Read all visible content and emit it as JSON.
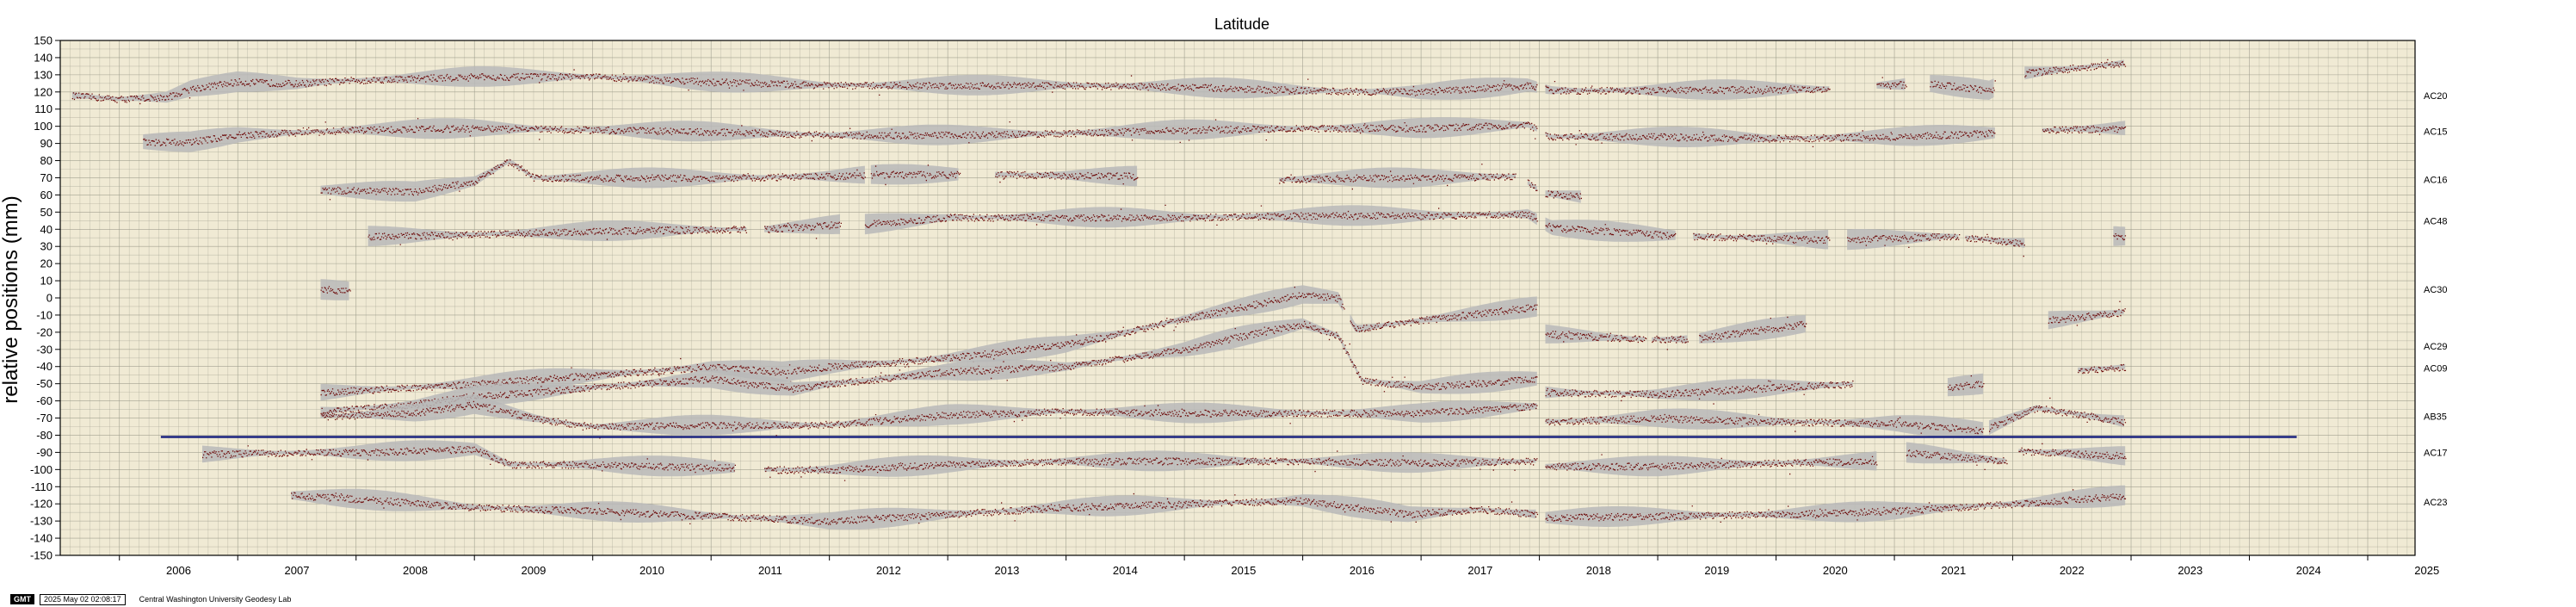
{
  "chart_data": {
    "type": "scatter",
    "title": "Latitude",
    "ylabel": "relative positions (mm)",
    "xlabel": "",
    "xlim": [
      2005.5,
      2025.4
    ],
    "ylim": [
      -150,
      150
    ],
    "y_ticks": [
      150,
      140,
      130,
      120,
      110,
      100,
      90,
      80,
      70,
      60,
      50,
      40,
      30,
      20,
      10,
      0,
      -10,
      -20,
      -30,
      -40,
      -50,
      -60,
      -70,
      -80,
      -90,
      -100,
      -110,
      -120,
      -130,
      -140,
      -150
    ],
    "x_ticks": [
      2006,
      2007,
      2008,
      2009,
      2010,
      2011,
      2012,
      2013,
      2014,
      2015,
      2016,
      2017,
      2018,
      2019,
      2020,
      2021,
      2022,
      2023,
      2024,
      2025
    ],
    "x_tick_labels": [
      "2006",
      "2007",
      "2008",
      "2009",
      "2010",
      "2011",
      "2012",
      "2013",
      "2014",
      "2015",
      "2016",
      "2017",
      "2018",
      "2019",
      "2020",
      "2021",
      "2022",
      "2023",
      "2024",
      "2025"
    ],
    "grid": true,
    "background_color": "#f0ead4",
    "point_color": "#6e0d0d",
    "error_band_color": "#b8b8b8",
    "reference_line": {
      "y": -81,
      "x_start": 2006.35,
      "x_end": 2024.4,
      "color": "#1a237e"
    },
    "series": [
      {
        "name": "AC20",
        "offset": 118,
        "segments": [
          [
            2005.6,
            2017.98
          ],
          [
            2018.05,
            2020.45
          ],
          [
            2020.85,
            2021.1
          ],
          [
            2021.3,
            2021.85
          ],
          [
            2022.1,
            2022.95
          ]
        ],
        "anchors": [
          [
            2005.6,
            118
          ],
          [
            2006.0,
            116
          ],
          [
            2006.4,
            117
          ],
          [
            2006.6,
            122
          ],
          [
            2007.0,
            126
          ],
          [
            2007.5,
            125
          ],
          [
            2008.0,
            127
          ],
          [
            2009.0,
            129
          ],
          [
            2010.0,
            129
          ],
          [
            2011.0,
            126
          ],
          [
            2012.0,
            124
          ],
          [
            2013.0,
            124
          ],
          [
            2014.0,
            124
          ],
          [
            2015.0,
            123
          ],
          [
            2016.0,
            121
          ],
          [
            2017.0,
            120
          ],
          [
            2017.9,
            124
          ],
          [
            2018.1,
            121
          ],
          [
            2019.0,
            121
          ],
          [
            2020.4,
            122
          ],
          [
            2020.9,
            124
          ],
          [
            2021.3,
            125
          ],
          [
            2021.8,
            121
          ],
          [
            2022.1,
            131
          ],
          [
            2022.95,
            137
          ]
        ]
      },
      {
        "name": "AC15",
        "offset": 97,
        "segments": [
          [
            2006.2,
            2017.98
          ],
          [
            2018.05,
            2021.85
          ],
          [
            2022.25,
            2022.95
          ]
        ],
        "anchors": [
          [
            2006.2,
            91
          ],
          [
            2006.6,
            91
          ],
          [
            2007.0,
            95
          ],
          [
            2008.0,
            98
          ],
          [
            2009.0,
            99
          ],
          [
            2010.0,
            98
          ],
          [
            2011.0,
            97
          ],
          [
            2012.0,
            95
          ],
          [
            2013.0,
            95
          ],
          [
            2014.0,
            96
          ],
          [
            2015.0,
            98
          ],
          [
            2016.0,
            99
          ],
          [
            2017.0,
            99
          ],
          [
            2017.9,
            101
          ],
          [
            2018.1,
            94
          ],
          [
            2019.0,
            94
          ],
          [
            2020.0,
            93
          ],
          [
            2021.0,
            94
          ],
          [
            2021.8,
            96
          ],
          [
            2022.3,
            98
          ],
          [
            2022.95,
            99
          ]
        ]
      },
      {
        "name": "AC16",
        "offset": 69,
        "segments": [
          [
            2007.7,
            2012.3
          ],
          [
            2012.35,
            2013.1
          ],
          [
            2013.4,
            2014.6
          ],
          [
            2015.8,
            2017.8
          ],
          [
            2017.9,
            2017.98
          ],
          [
            2018.05,
            2018.35
          ]
        ],
        "anchors": [
          [
            2007.7,
            63
          ],
          [
            2008.5,
            62
          ],
          [
            2009.0,
            68
          ],
          [
            2009.3,
            80
          ],
          [
            2009.5,
            70
          ],
          [
            2010.0,
            70
          ],
          [
            2011.0,
            70
          ],
          [
            2012.0,
            71
          ],
          [
            2012.4,
            72
          ],
          [
            2013.0,
            72
          ],
          [
            2013.4,
            72
          ],
          [
            2014.6,
            71
          ],
          [
            2015.8,
            69
          ],
          [
            2016.5,
            70
          ],
          [
            2017.0,
            70
          ],
          [
            2017.8,
            71
          ],
          [
            2018.05,
            61
          ],
          [
            2018.35,
            59
          ]
        ]
      },
      {
        "name": "AC48",
        "offset": 45,
        "segments": [
          [
            2008.1,
            2011.3
          ],
          [
            2011.45,
            2012.1
          ],
          [
            2012.3,
            2017.98
          ],
          [
            2018.05,
            2019.15
          ],
          [
            2019.3,
            2020.45
          ],
          [
            2020.6,
            2021.55
          ],
          [
            2021.6,
            2022.1
          ],
          [
            2022.85,
            2022.95
          ]
        ],
        "anchors": [
          [
            2008.1,
            36
          ],
          [
            2009.0,
            37
          ],
          [
            2010.0,
            39
          ],
          [
            2011.0,
            40
          ],
          [
            2011.45,
            40
          ],
          [
            2012.1,
            43
          ],
          [
            2012.3,
            43
          ],
          [
            2013.0,
            47
          ],
          [
            2014.0,
            47
          ],
          [
            2015.0,
            47
          ],
          [
            2016.0,
            48
          ],
          [
            2017.0,
            48
          ],
          [
            2017.9,
            49
          ],
          [
            2018.1,
            41
          ],
          [
            2019.0,
            37
          ],
          [
            2019.3,
            36
          ],
          [
            2020.4,
            34
          ],
          [
            2020.6,
            34
          ],
          [
            2021.5,
            36
          ],
          [
            2022.1,
            32
          ],
          [
            2022.85,
            36
          ],
          [
            2022.95,
            36
          ]
        ]
      },
      {
        "name": "AC30",
        "offset": 5,
        "segments": [
          [
            2007.7,
            2007.95
          ]
        ],
        "anchors": [
          [
            2007.7,
            5
          ],
          [
            2007.95,
            4
          ]
        ]
      },
      {
        "name": "AC29",
        "offset": -28,
        "segments": [
          [
            2007.7,
            2016.35
          ],
          [
            2016.4,
            2017.98
          ],
          [
            2018.05,
            2018.9
          ],
          [
            2018.95,
            2019.25
          ],
          [
            2019.35,
            2020.25
          ],
          [
            2022.3,
            2022.95
          ]
        ],
        "anchors": [
          [
            2007.7,
            -55
          ],
          [
            2008.5,
            -52
          ],
          [
            2009.0,
            -50
          ],
          [
            2010.0,
            -45
          ],
          [
            2011.0,
            -40
          ],
          [
            2011.6,
            -43
          ],
          [
            2012.0,
            -40
          ],
          [
            2013.0,
            -35
          ],
          [
            2014.0,
            -27
          ],
          [
            2014.5,
            -20
          ],
          [
            2015.0,
            -12
          ],
          [
            2015.5,
            -5
          ],
          [
            2016.0,
            2
          ],
          [
            2016.3,
            0
          ],
          [
            2016.45,
            -18
          ],
          [
            2017.0,
            -13
          ],
          [
            2017.98,
            -5
          ],
          [
            2018.05,
            -21
          ],
          [
            2018.9,
            -24
          ],
          [
            2019.3,
            -24
          ],
          [
            2020.25,
            -15
          ],
          [
            2022.3,
            -13
          ],
          [
            2022.95,
            -8
          ]
        ]
      },
      {
        "name": "AC09",
        "offset": -41,
        "segments": [
          [
            2007.7,
            2017.98
          ],
          [
            2018.05,
            2020.65
          ],
          [
            2021.45,
            2021.75
          ],
          [
            2022.55,
            2022.95
          ]
        ],
        "anchors": [
          [
            2007.7,
            -66
          ],
          [
            2008.5,
            -62
          ],
          [
            2009.0,
            -57
          ],
          [
            2009.5,
            -55
          ],
          [
            2010.0,
            -52
          ],
          [
            2011.0,
            -47
          ],
          [
            2011.7,
            -53
          ],
          [
            2012.0,
            -50
          ],
          [
            2013.0,
            -43
          ],
          [
            2014.0,
            -40
          ],
          [
            2015.0,
            -30
          ],
          [
            2015.5,
            -22
          ],
          [
            2016.0,
            -15
          ],
          [
            2016.3,
            -22
          ],
          [
            2016.5,
            -48
          ],
          [
            2017.0,
            -52
          ],
          [
            2017.98,
            -47
          ],
          [
            2018.05,
            -55
          ],
          [
            2019.0,
            -56
          ],
          [
            2020.0,
            -52
          ],
          [
            2020.65,
            -50
          ],
          [
            2021.45,
            -52
          ],
          [
            2021.75,
            -50
          ],
          [
            2022.55,
            -42
          ],
          [
            2022.95,
            -40
          ]
        ]
      },
      {
        "name": "AB35",
        "offset": -69,
        "segments": [
          [
            2007.7,
            2017.98
          ],
          [
            2018.05,
            2021.75
          ],
          [
            2021.8,
            2022.95
          ]
        ],
        "anchors": [
          [
            2007.7,
            -69
          ],
          [
            2008.5,
            -67
          ],
          [
            2009.0,
            -62
          ],
          [
            2009.5,
            -70
          ],
          [
            2010.0,
            -75
          ],
          [
            2011.0,
            -74
          ],
          [
            2012.0,
            -74
          ],
          [
            2013.0,
            -68
          ],
          [
            2014.0,
            -66
          ],
          [
            2015.0,
            -67
          ],
          [
            2016.0,
            -67
          ],
          [
            2017.0,
            -67
          ],
          [
            2017.98,
            -63
          ],
          [
            2018.05,
            -72
          ],
          [
            2019.0,
            -70
          ],
          [
            2020.0,
            -72
          ],
          [
            2021.0,
            -73
          ],
          [
            2021.75,
            -77
          ],
          [
            2022.2,
            -64
          ],
          [
            2022.95,
            -72
          ]
        ]
      },
      {
        "name": "AC17",
        "offset": -90,
        "segments": [
          [
            2006.7,
            2011.2
          ],
          [
            2011.45,
            2017.98
          ],
          [
            2018.05,
            2020.85
          ],
          [
            2021.1,
            2021.95
          ],
          [
            2022.05,
            2022.95
          ]
        ],
        "anchors": [
          [
            2006.7,
            -91
          ],
          [
            2007.5,
            -90
          ],
          [
            2008.0,
            -90
          ],
          [
            2009.0,
            -88
          ],
          [
            2009.3,
            -97
          ],
          [
            2010.0,
            -97
          ],
          [
            2011.2,
            -99
          ],
          [
            2011.45,
            -100
          ],
          [
            2012.0,
            -100
          ],
          [
            2013.0,
            -97
          ],
          [
            2014.0,
            -95
          ],
          [
            2015.0,
            -95
          ],
          [
            2016.0,
            -95
          ],
          [
            2017.0,
            -96
          ],
          [
            2017.98,
            -95
          ],
          [
            2018.05,
            -98
          ],
          [
            2019.0,
            -98
          ],
          [
            2020.0,
            -96
          ],
          [
            2020.85,
            -95
          ],
          [
            2021.1,
            -90
          ],
          [
            2021.95,
            -95
          ],
          [
            2022.05,
            -89
          ],
          [
            2022.95,
            -92
          ]
        ]
      },
      {
        "name": "AC23",
        "offset": -119,
        "segments": [
          [
            2007.45,
            2017.98
          ],
          [
            2018.05,
            2022.95
          ]
        ],
        "anchors": [
          [
            2007.45,
            -115
          ],
          [
            2008.0,
            -117
          ],
          [
            2009.0,
            -122
          ],
          [
            2010.0,
            -124
          ],
          [
            2011.0,
            -127
          ],
          [
            2012.0,
            -130
          ],
          [
            2013.0,
            -126
          ],
          [
            2014.0,
            -122
          ],
          [
            2015.0,
            -120
          ],
          [
            2016.0,
            -118
          ],
          [
            2016.9,
            -126
          ],
          [
            2017.5,
            -123
          ],
          [
            2017.98,
            -126
          ],
          [
            2018.05,
            -128
          ],
          [
            2019.0,
            -127
          ],
          [
            2020.0,
            -126
          ],
          [
            2021.0,
            -124
          ],
          [
            2022.0,
            -120
          ],
          [
            2022.95,
            -115
          ]
        ]
      }
    ]
  },
  "footer": {
    "logo": "GMT",
    "timestamp": "2025 May 02 02:08:17",
    "credit": "Central Washington University Geodesy Lab"
  }
}
